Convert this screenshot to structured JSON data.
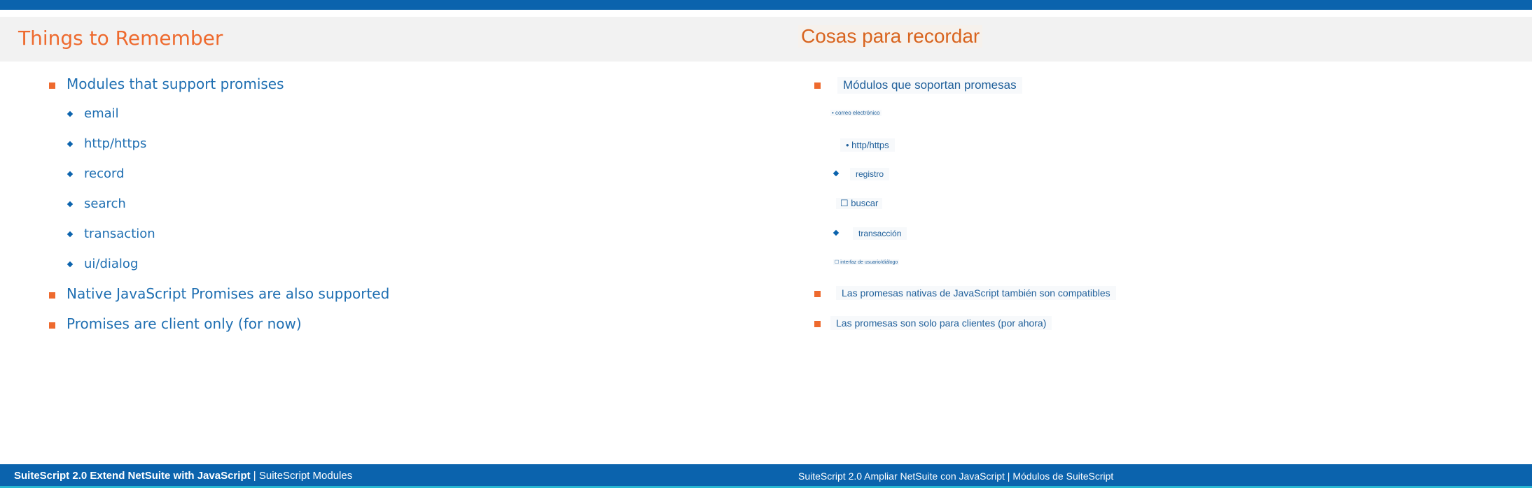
{
  "slide": {
    "title_en": "Things to Remember",
    "title_es": "Cosas para recordar",
    "bullets_en": [
      "Modules that support promises",
      "email",
      "http/https",
      "record",
      "search",
      "transaction",
      "ui/dialog",
      "Native JavaScript Promises are also supported",
      "Promises are client only (for now)"
    ],
    "bullets_es": [
      "Módulos que soportan promesas",
      "• correo electrónico",
      "• http/https",
      "registro",
      "☐ buscar",
      "transacción",
      "☐ interfaz de usuario/diálogo",
      "Las promesas nativas de JavaScript también son compatibles",
      "Las promesas son solo para clientes (por ahora)"
    ]
  },
  "footer": {
    "en_bold": "SuiteScript 2.0 Extend NetSuite with JavaScript",
    "en_rest": " | SuiteScript Modules",
    "es": "SuiteScript 2.0 Ampliar NetSuite con JavaScript | Módulos de SuiteScript"
  },
  "colors": {
    "brand_blue": "#0b63ad",
    "accent_orange": "#ee6a2e",
    "text_blue": "#1f6fb2"
  }
}
